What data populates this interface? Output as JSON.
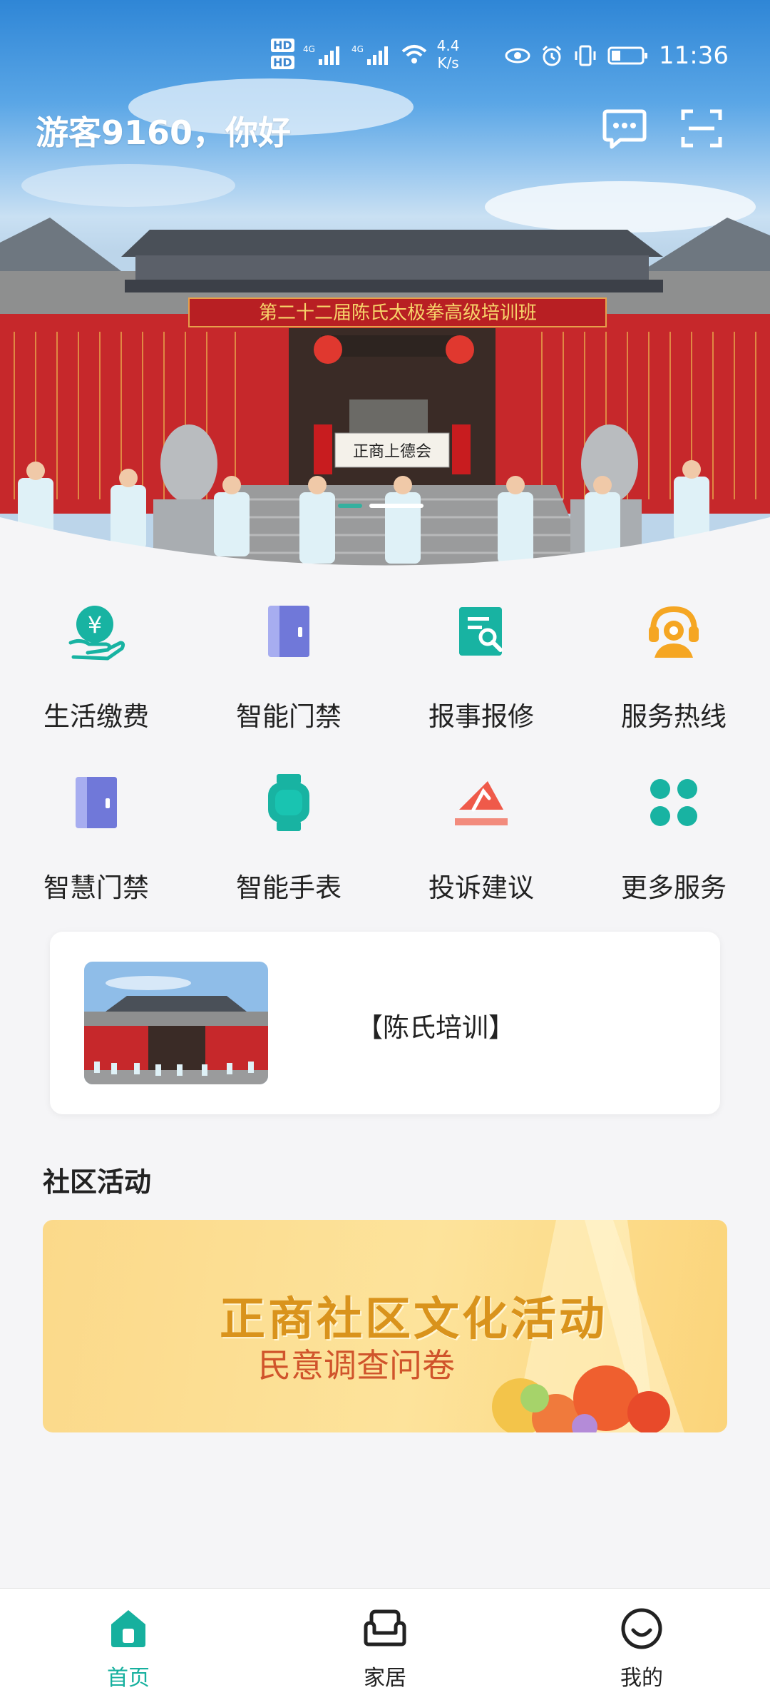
{
  "status_bar": {
    "hd1": "HD",
    "hd2": "HD",
    "network1": "4G",
    "network2": "4G",
    "speed_value": "4.4",
    "speed_unit": "K/s",
    "time": "11:36"
  },
  "header": {
    "greeting": "游客9160，你好",
    "message_icon": "message-icon",
    "scan_icon": "scan-icon"
  },
  "hero": {
    "banner_text": "第二十二届陈氏太极拳高级培训班",
    "plaque_text": "正商上德会",
    "slides_count": 2,
    "active_slide": 2
  },
  "services": [
    {
      "label": "生活缴费",
      "icon": "payment-icon",
      "color": "#18b3a2"
    },
    {
      "label": "智能门禁",
      "icon": "door-icon",
      "color": "#7f86df"
    },
    {
      "label": "报事报修",
      "icon": "repair-icon",
      "color": "#18b3a2"
    },
    {
      "label": "服务热线",
      "icon": "hotline-icon",
      "color": "#f5a623"
    },
    {
      "label": "智慧门禁",
      "icon": "door-icon",
      "color": "#7f86df"
    },
    {
      "label": "智能手表",
      "icon": "watch-icon",
      "color": "#18b3a2"
    },
    {
      "label": "投诉建议",
      "icon": "complaint-icon",
      "color": "#ef5a4a"
    },
    {
      "label": "更多服务",
      "icon": "more-icon",
      "color": "#18b3a2"
    }
  ],
  "news": {
    "title": "【陈氏培训】"
  },
  "community": {
    "section_title": "社区活动",
    "banner_title": "正商社区文化活动",
    "banner_subtitle": "民意调查问卷"
  },
  "bottom_nav": [
    {
      "label": "首页",
      "icon": "home-icon",
      "active": true
    },
    {
      "label": "家居",
      "icon": "sofa-icon",
      "active": false
    },
    {
      "label": "我的",
      "icon": "smile-icon",
      "active": false
    }
  ],
  "colors": {
    "accent": "#16b09e",
    "background": "#f5f5f7"
  }
}
